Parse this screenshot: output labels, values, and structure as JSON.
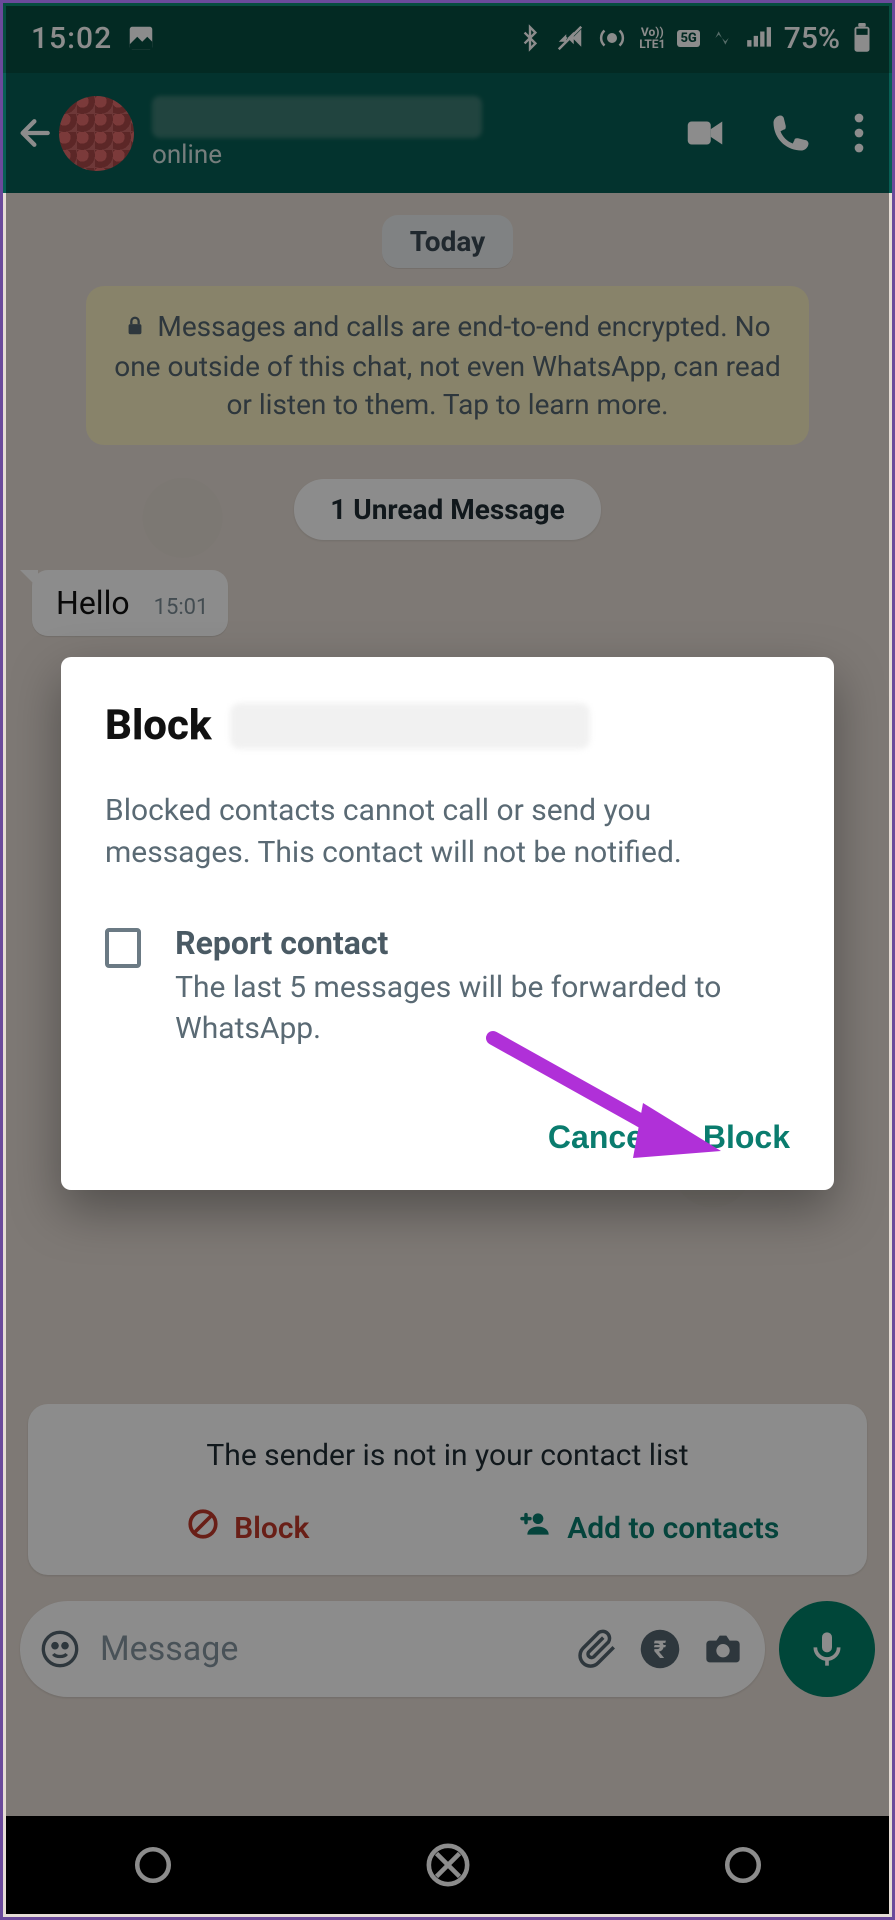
{
  "statusbar": {
    "time": "15:02",
    "battery_pct": "75%"
  },
  "header": {
    "status": "online"
  },
  "chat": {
    "date_label": "Today",
    "e2e_notice": "Messages and calls are end-to-end encrypted. No one outside of this chat, not even WhatsApp, can read or listen to them. Tap to learn more.",
    "unread_label": "1 Unread Message",
    "messages": [
      {
        "text": "Hello",
        "time": "15:01"
      }
    ]
  },
  "stranger": {
    "title": "The sender is not in your contact list",
    "block_label": "Block",
    "add_label": "Add to contacts"
  },
  "composer": {
    "placeholder": "Message"
  },
  "dialog": {
    "title_prefix": "Block",
    "description": "Blocked contacts cannot call or send you messages. This contact will not be notified.",
    "report_title": "Report contact",
    "report_sub": "The last 5 messages will be forwarded to WhatsApp.",
    "cancel": "Cancel",
    "block": "Block"
  }
}
